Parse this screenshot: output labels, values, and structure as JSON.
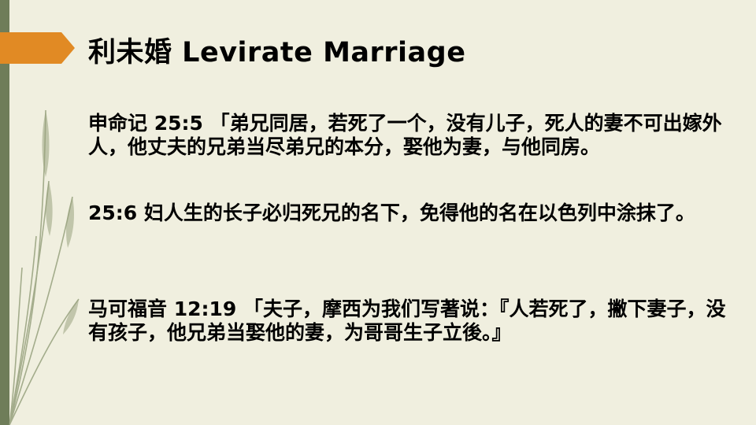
{
  "slide": {
    "title": "利未婚 Levirate Marriage",
    "paragraphs": [
      "申命记  25:5 「弟兄同居，若死了一个，没有儿子，死人的妻不可出嫁外人，他丈夫的兄弟当尽弟兄的本分，娶他为妻，与他同房。",
      "25:6  妇人生的长子必归死兄的名下，免得他的名在以色列中涂抹了。",
      "马可福音 12:19 「夫子，摩西为我们写著说：『人若死了，撇下妻子，没有孩子，他兄弟当娶他的妻，为哥哥生子立後。』"
    ]
  },
  "colors": {
    "background": "#f0efdf",
    "accent_orange": "#e18a24",
    "accent_green": "#6f7d59"
  },
  "icons": {
    "title_marker": "orange-arrow-icon",
    "decoration": "leaf-lines-decoration"
  }
}
